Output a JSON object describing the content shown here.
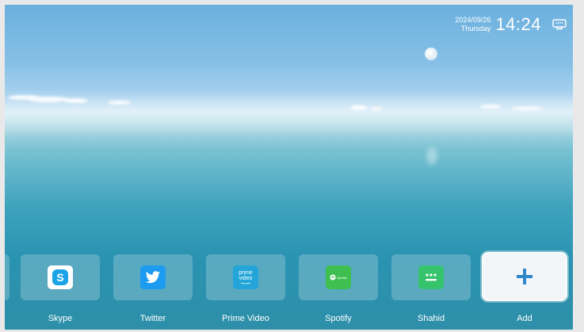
{
  "status": {
    "date": "2024/09/26",
    "weekday": "Thursday",
    "time": "14:24",
    "network_icon": "ethernet-icon"
  },
  "apps": [
    {
      "label": "Skype",
      "icon": "skype-icon",
      "color": "#ffffff",
      "accent": "#1aa3e6"
    },
    {
      "label": "Twitter",
      "icon": "twitter-icon",
      "color": "#1d9bf0"
    },
    {
      "label": "Prime Video",
      "icon": "prime-video-icon",
      "color": "#23a5d9",
      "icon_text_1": "prime",
      "icon_text_2": "video"
    },
    {
      "label": "Spotify",
      "icon": "spotify-icon",
      "color": "#3fbf4f",
      "icon_text": "Spotify"
    },
    {
      "label": "Shahid",
      "icon": "shahid-icon",
      "color": "#35c46b"
    },
    {
      "label": "Add",
      "icon": "plus-icon",
      "color": "#2f86c9"
    }
  ]
}
